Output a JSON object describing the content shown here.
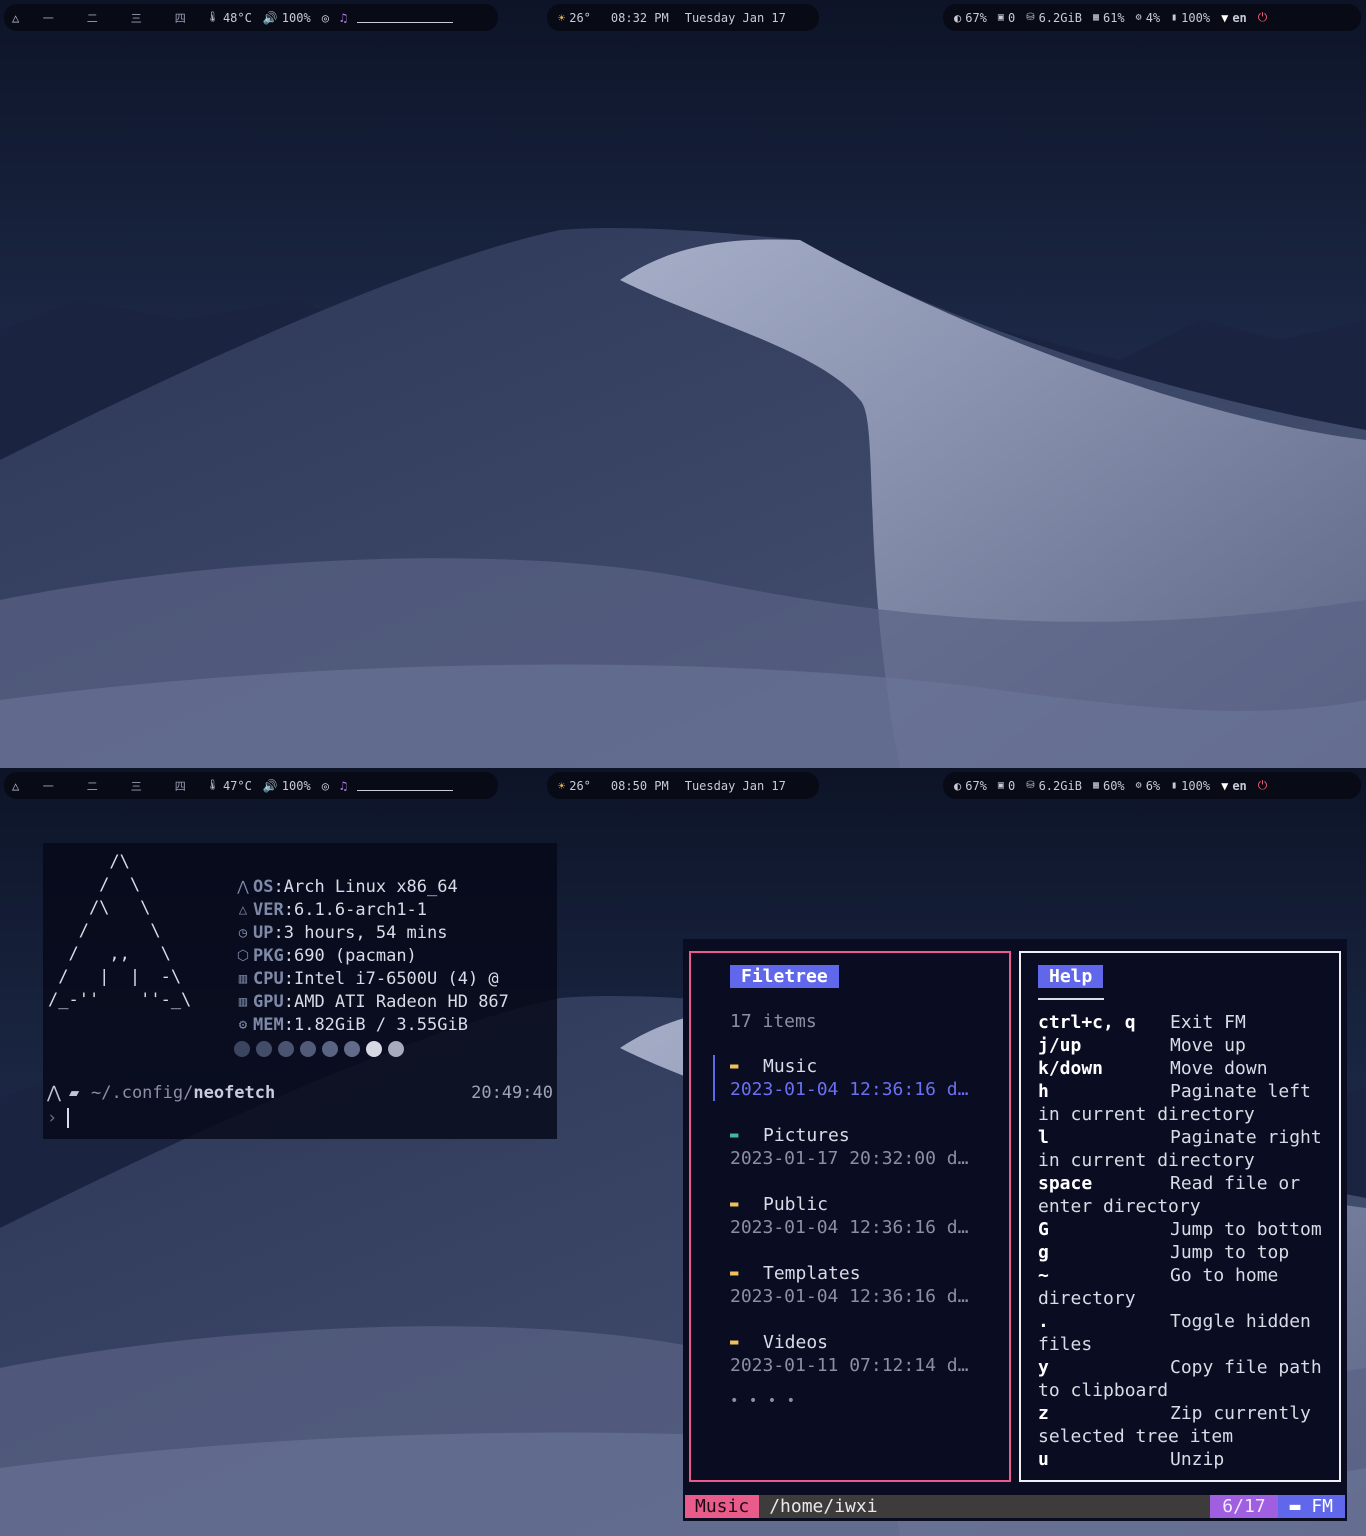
{
  "screens": [
    {
      "bar": {
        "workspaces": [
          "一",
          "二",
          "三",
          "四"
        ],
        "temperature": "48°C",
        "volume": "100%",
        "weather_temp": "26°",
        "time": "08:32 PM",
        "date": "Tuesday Jan 17",
        "brightness": "67%",
        "updates": "0",
        "disk": "6.2GiB",
        "memory": "61%",
        "cpu": "4%",
        "battery": "100%",
        "language": "en"
      }
    },
    {
      "bar": {
        "workspaces": [
          "一",
          "二",
          "三",
          "四"
        ],
        "temperature": "47°C",
        "volume": "100%",
        "weather_temp": "26°",
        "time": "08:50 PM",
        "date": "Tuesday Jan 17",
        "brightness": "67%",
        "updates": "0",
        "disk": "6.2GiB",
        "memory": "60%",
        "cpu": "6%",
        "battery": "100%",
        "language": "en"
      }
    }
  ],
  "icons": {
    "arch": "arch-icon",
    "temp": "thermometer-icon",
    "volume": "volume-icon",
    "privacy": "eye-slash-icon",
    "music": "music-note-icon",
    "weather": "sun-icon",
    "brightness": "brightness-icon",
    "updates": "package-icon",
    "disk": "hard-drive-icon",
    "memory": "memory-chip-icon",
    "cpu": "cpu-icon",
    "battery": "battery-icon",
    "wifi": "wifi-icon",
    "power": "power-icon"
  },
  "neofetch": {
    "ascii_art": "      /\\\n     /  \\\n    /\\   \\\n   /      \\\n  /   ,,   \\\n /   |  |  -\\\n/_-''    ''-_\\",
    "rows": [
      {
        "key": "OS",
        "sep": " : ",
        "value": "Arch Linux x86_64"
      },
      {
        "key": "VER",
        "sep": ": ",
        "value": "6.1.6-arch1-1"
      },
      {
        "key": "UP",
        "sep": " : ",
        "value": "3 hours, 54 mins"
      },
      {
        "key": "PKG",
        "sep": ": ",
        "value": "690 (pacman)"
      },
      {
        "key": "CPU",
        "sep": ": ",
        "value": "Intel i7-6500U (4) @"
      },
      {
        "key": "GPU",
        "sep": ": ",
        "value": "AMD ATI Radeon HD 867"
      },
      {
        "key": "MEM",
        "sep": ": ",
        "value": "1.82GiB / 3.55GiB"
      }
    ],
    "palette": [
      "#3c4560",
      "#434c68",
      "#4a5370",
      "#515a78",
      "#5a6382",
      "#636b8a",
      "#d6d9e4",
      "#a7abbc"
    ],
    "cwd_prefix": "~/.config/",
    "cwd_dir": "neofetch",
    "time": "20:49:40"
  },
  "filemanager": {
    "tree_title": "Filetree",
    "item_count": "17 items",
    "entries": [
      {
        "name": "Music",
        "meta": "2023-01-04 12:36:16 d…",
        "icon_color": "#f1c05a"
      },
      {
        "name": "Pictures",
        "meta": "2023-01-17 20:32:00 d…",
        "icon_color": "#3fb6a8"
      },
      {
        "name": "Public",
        "meta": "2023-01-04 12:36:16 d…",
        "icon_color": "#f1c05a"
      },
      {
        "name": "Templates",
        "meta": "2023-01-04 12:36:16 d…",
        "icon_color": "#f1c05a"
      },
      {
        "name": "Videos",
        "meta": "2023-01-11 07:12:14 d…",
        "icon_color": "#f1c05a"
      }
    ],
    "more": "• • • •",
    "help_title": "Help",
    "help_lines": [
      {
        "key": "ctrl+c, q",
        "desc": "Exit FM"
      },
      {
        "key": "j/up",
        "desc": "Move up"
      },
      {
        "key": "k/down",
        "desc": "Move down"
      },
      {
        "key": "h",
        "desc": "Paginate left"
      },
      {
        "key": "",
        "desc": "in current directory"
      },
      {
        "key": "l",
        "desc": "Paginate right"
      },
      {
        "key": "",
        "desc": "in current directory"
      },
      {
        "key": "space",
        "desc": "Read file or"
      },
      {
        "key": "",
        "desc": "enter directory"
      },
      {
        "key": "G",
        "desc": "Jump to bottom"
      },
      {
        "key": "g",
        "desc": "Jump to top"
      },
      {
        "key": "~",
        "desc": "Go to home"
      },
      {
        "key": "",
        "desc": "directory"
      },
      {
        "key": ".",
        "desc": "Toggle hidden"
      },
      {
        "key": "",
        "desc": "files"
      },
      {
        "key": "y",
        "desc": "Copy file path"
      },
      {
        "key": "",
        "desc": "to clipboard"
      },
      {
        "key": "z",
        "desc": "Zip currently"
      },
      {
        "key": "",
        "desc": "selected tree item"
      },
      {
        "key": "u",
        "desc": "Unzip"
      }
    ],
    "status": {
      "mode": "Music",
      "path": "/home/iwxi",
      "count": "6/17",
      "label": "FM"
    }
  }
}
